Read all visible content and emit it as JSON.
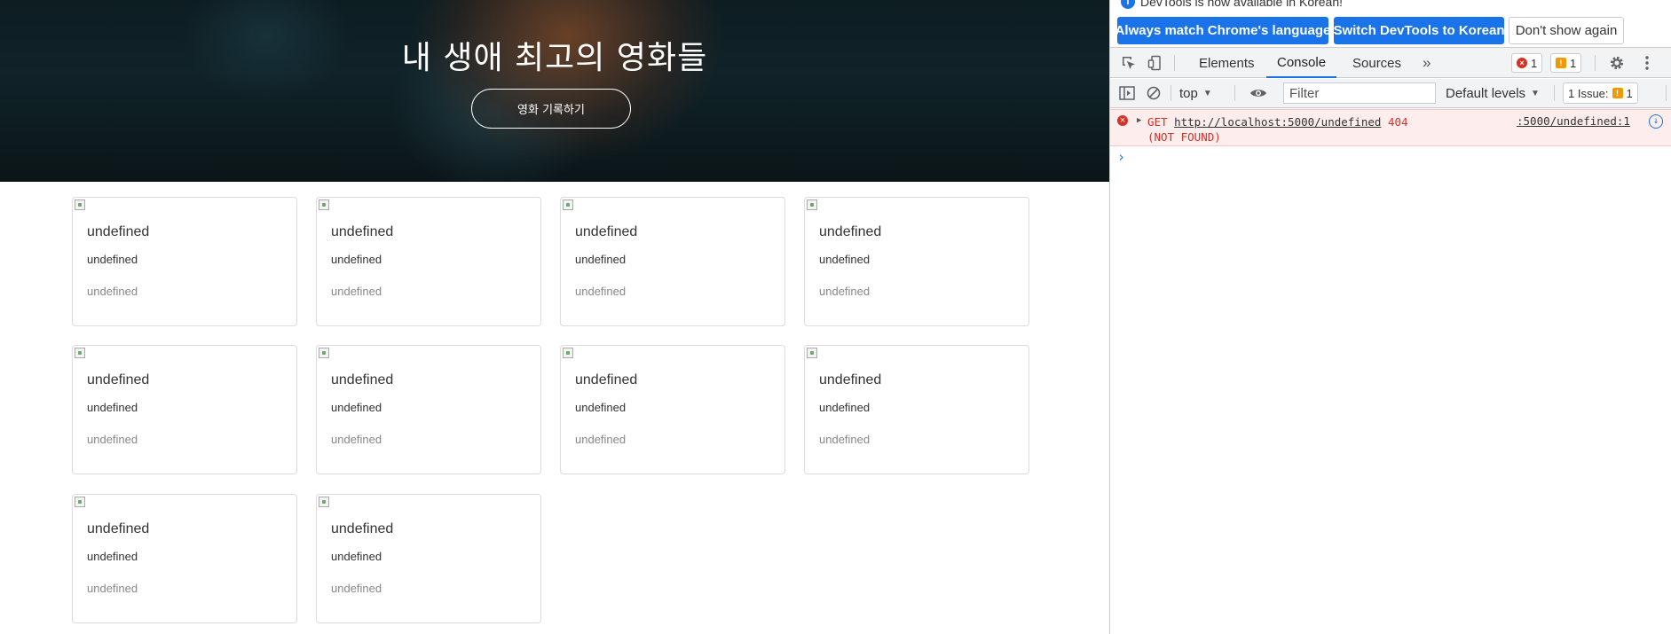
{
  "hero": {
    "title": "내 생애 최고의 영화들",
    "button_label": "영화 기록하기"
  },
  "cards": [
    {
      "title": "undefined",
      "desc": "undefined",
      "comment": "undefined"
    },
    {
      "title": "undefined",
      "desc": "undefined",
      "comment": "undefined"
    },
    {
      "title": "undefined",
      "desc": "undefined",
      "comment": "undefined"
    },
    {
      "title": "undefined",
      "desc": "undefined",
      "comment": "undefined"
    },
    {
      "title": "undefined",
      "desc": "undefined",
      "comment": "undefined"
    },
    {
      "title": "undefined",
      "desc": "undefined",
      "comment": "undefined"
    },
    {
      "title": "undefined",
      "desc": "undefined",
      "comment": "undefined"
    },
    {
      "title": "undefined",
      "desc": "undefined",
      "comment": "undefined"
    },
    {
      "title": "undefined",
      "desc": "undefined",
      "comment": "undefined"
    },
    {
      "title": "undefined",
      "desc": "undefined",
      "comment": "undefined"
    }
  ],
  "devtools": {
    "infobar": {
      "text": "DevTools is now available in Korean!",
      "match_language": "Always match Chrome's language",
      "switch_language": "Switch DevTools to Korean",
      "dont_show": "Don't show again"
    },
    "tabs": [
      {
        "label": "Elements"
      },
      {
        "label": "Console"
      },
      {
        "label": "Sources"
      }
    ],
    "more_tabs": "»",
    "error_count": "1",
    "warning_count": "1",
    "toolbar": {
      "context": "top",
      "filter_placeholder": "Filter",
      "levels": "Default levels",
      "issues_label": "1 Issue:",
      "issues_count": "1"
    },
    "console": {
      "error_method": "GET",
      "error_url": "http://localhost:5000/undefined",
      "error_status": "404 (NOT FOUND)",
      "error_source": ":5000/undefined:1",
      "prompt": "›"
    }
  }
}
